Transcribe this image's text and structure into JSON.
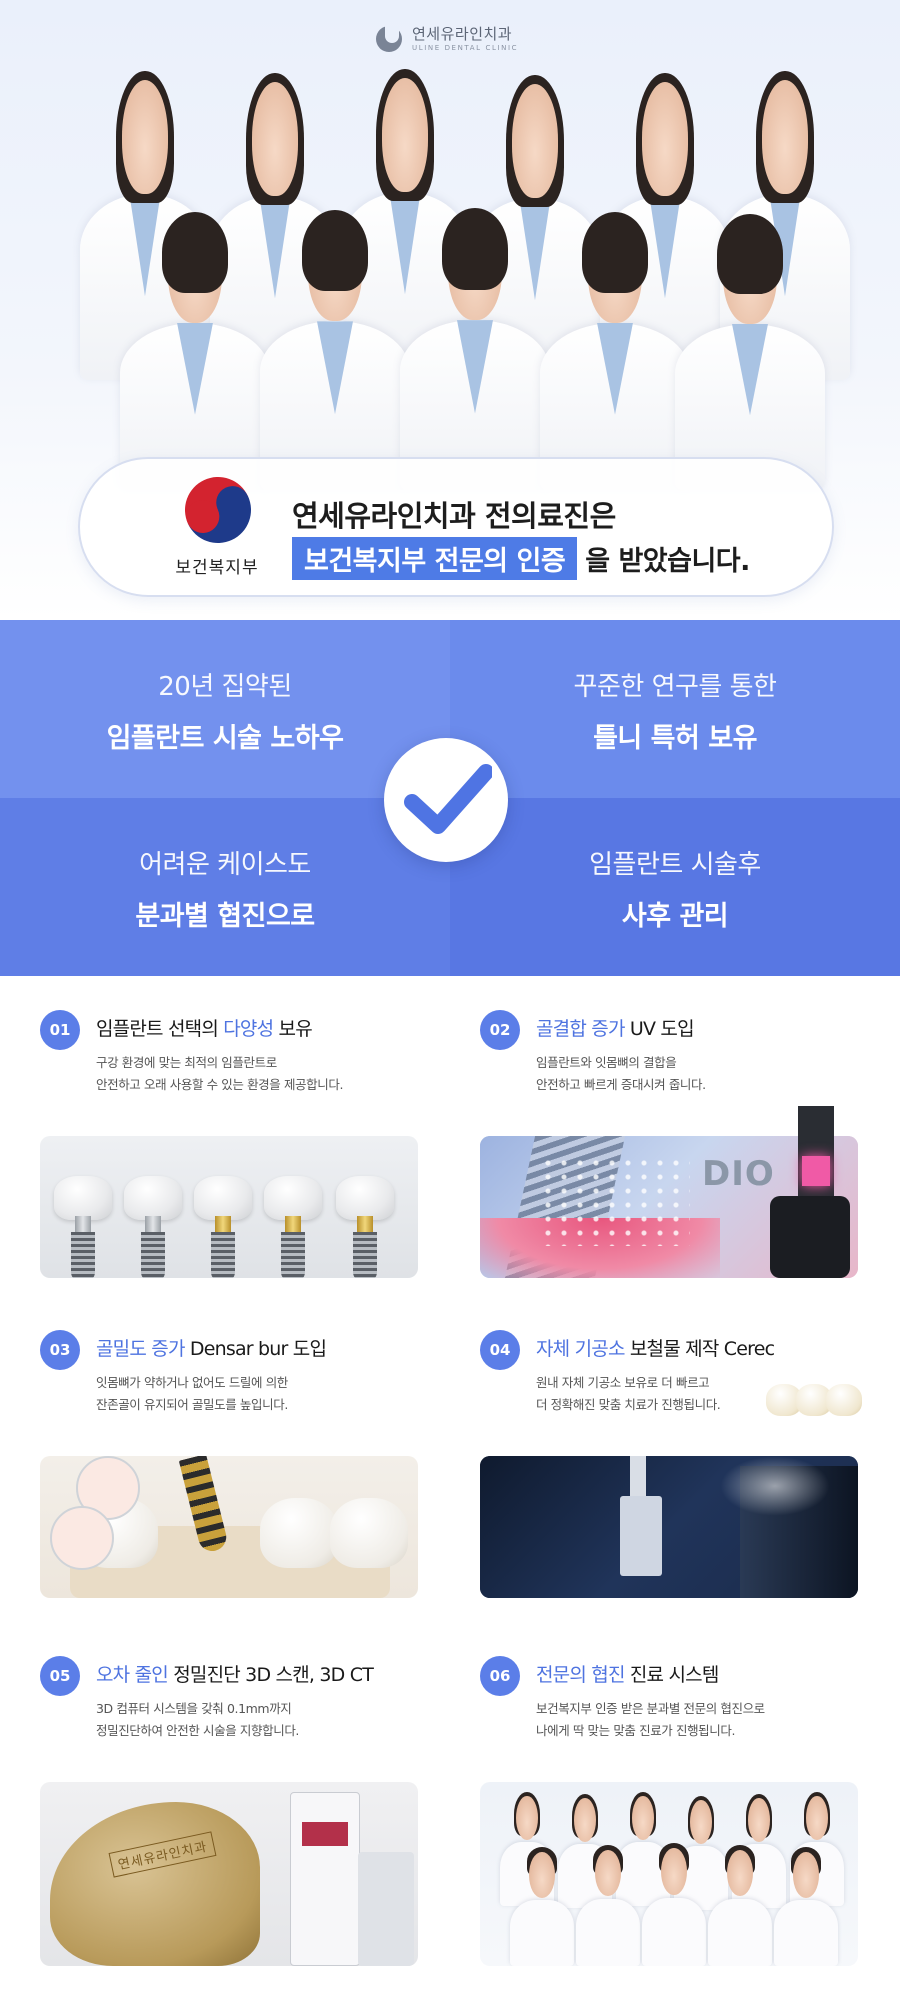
{
  "logo": {
    "name_ko": "연세유라인치과",
    "name_en": "ULINE DENTAL CLINIC"
  },
  "certification": {
    "ministry": "보건복지부",
    "line1": "연세유라인치과 전의료진은",
    "highlight": "보건복지부 전문의 인증",
    "line2_rest": "을 받았습니다."
  },
  "features": [
    {
      "sub": "20년 집약된",
      "main": "임플란트 시술 노하우"
    },
    {
      "sub": "꾸준한 연구를 통한",
      "main": "틀니 특허 보유"
    },
    {
      "sub": "어려운 케이스도",
      "main": "분과별 협진으로"
    },
    {
      "sub": "임플란트 시술후",
      "main": "사후 관리"
    }
  ],
  "colors": {
    "accent": "#4e7be6",
    "number_badge": "#5b7ee8",
    "feature_bg": "#6b8bec"
  },
  "items": [
    {
      "num": "01",
      "title_pre": "임플란트 선택의 ",
      "title_hl": "다양성",
      "title_post": " 보유",
      "desc1": "구강 환경에 맞는 최적의 임플란트로",
      "desc2": "안전하고 오래 사용할 수 있는 환경을 제공합니다."
    },
    {
      "num": "02",
      "title_pre": "",
      "title_hl": "골결합 증가",
      "title_post": " UV 도입",
      "desc1": "임플란트와 잇몸뼈의 결합을",
      "desc2": "안전하고 빠르게 증대시켜 줍니다.",
      "brand": "DIO"
    },
    {
      "num": "03",
      "title_pre": "",
      "title_hl": "골밀도 증가",
      "title_post": " Densar bur 도입",
      "desc1": "잇몸뼈가 약하거나 없어도 드릴에 의한",
      "desc2": "잔존골이 유지되어 골밀도를 높입니다."
    },
    {
      "num": "04",
      "title_pre": "",
      "title_hl": "자체 기공소",
      "title_post": " 보철물 제작 Cerec",
      "desc1": "원내 자체 기공소 보유로 더 빠르고",
      "desc2": "더 정확해진 맞춤 치료가 진행됩니다."
    },
    {
      "num": "05",
      "title_pre": "",
      "title_hl": "오차 줄인",
      "title_post": " 정밀진단 3D 스캔, 3D CT",
      "desc1": "3D 컴퓨터 시스템을 갖춰 0.1mm까지",
      "desc2": "정밀진단하여 안전한 시술을 지향합니다.",
      "stamp": "연세유라인치과"
    },
    {
      "num": "06",
      "title_pre": "",
      "title_hl": "전문의 협진",
      "title_post": " 진료 시스템",
      "desc1": "보건복지부 인증 받은 분과별 전문의 협진으로",
      "desc2": "나에게 딱 맞는 맞춤 진료가 진행됩니다."
    }
  ]
}
